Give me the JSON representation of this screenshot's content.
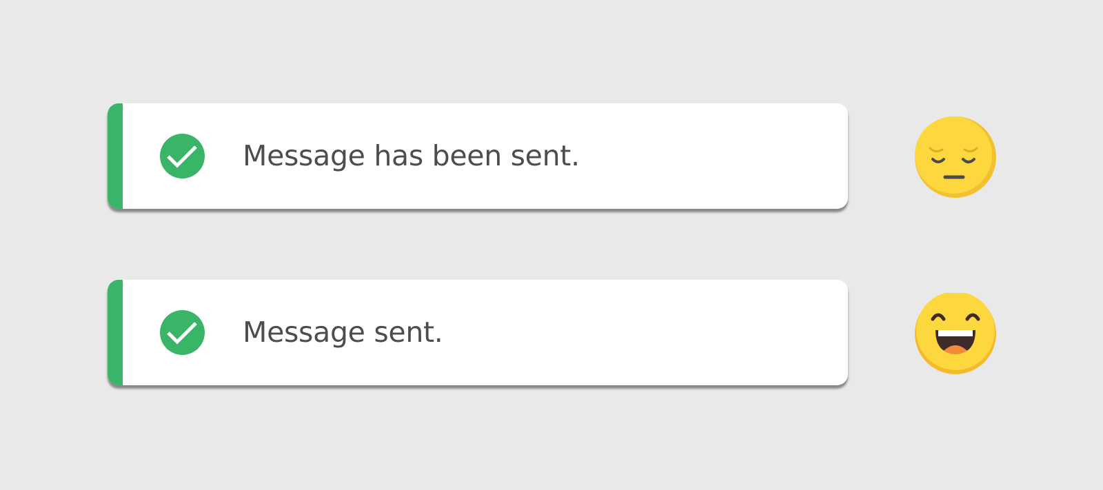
{
  "notifications": [
    {
      "message": "Message has been sent.",
      "status": "success",
      "icon": "check-circle-icon",
      "reaction_icon": "pensive-face-icon"
    },
    {
      "message": "Message sent.",
      "status": "success",
      "icon": "check-circle-icon",
      "reaction_icon": "grinning-face-icon"
    }
  ],
  "colors": {
    "background": "#e9e9e9",
    "toast_background": "#ffffff",
    "accent_success": "#3ab567",
    "message_text": "#4d4d4d",
    "emoji_face": "#fcd53a",
    "emoji_shade": "#f3c12f"
  }
}
